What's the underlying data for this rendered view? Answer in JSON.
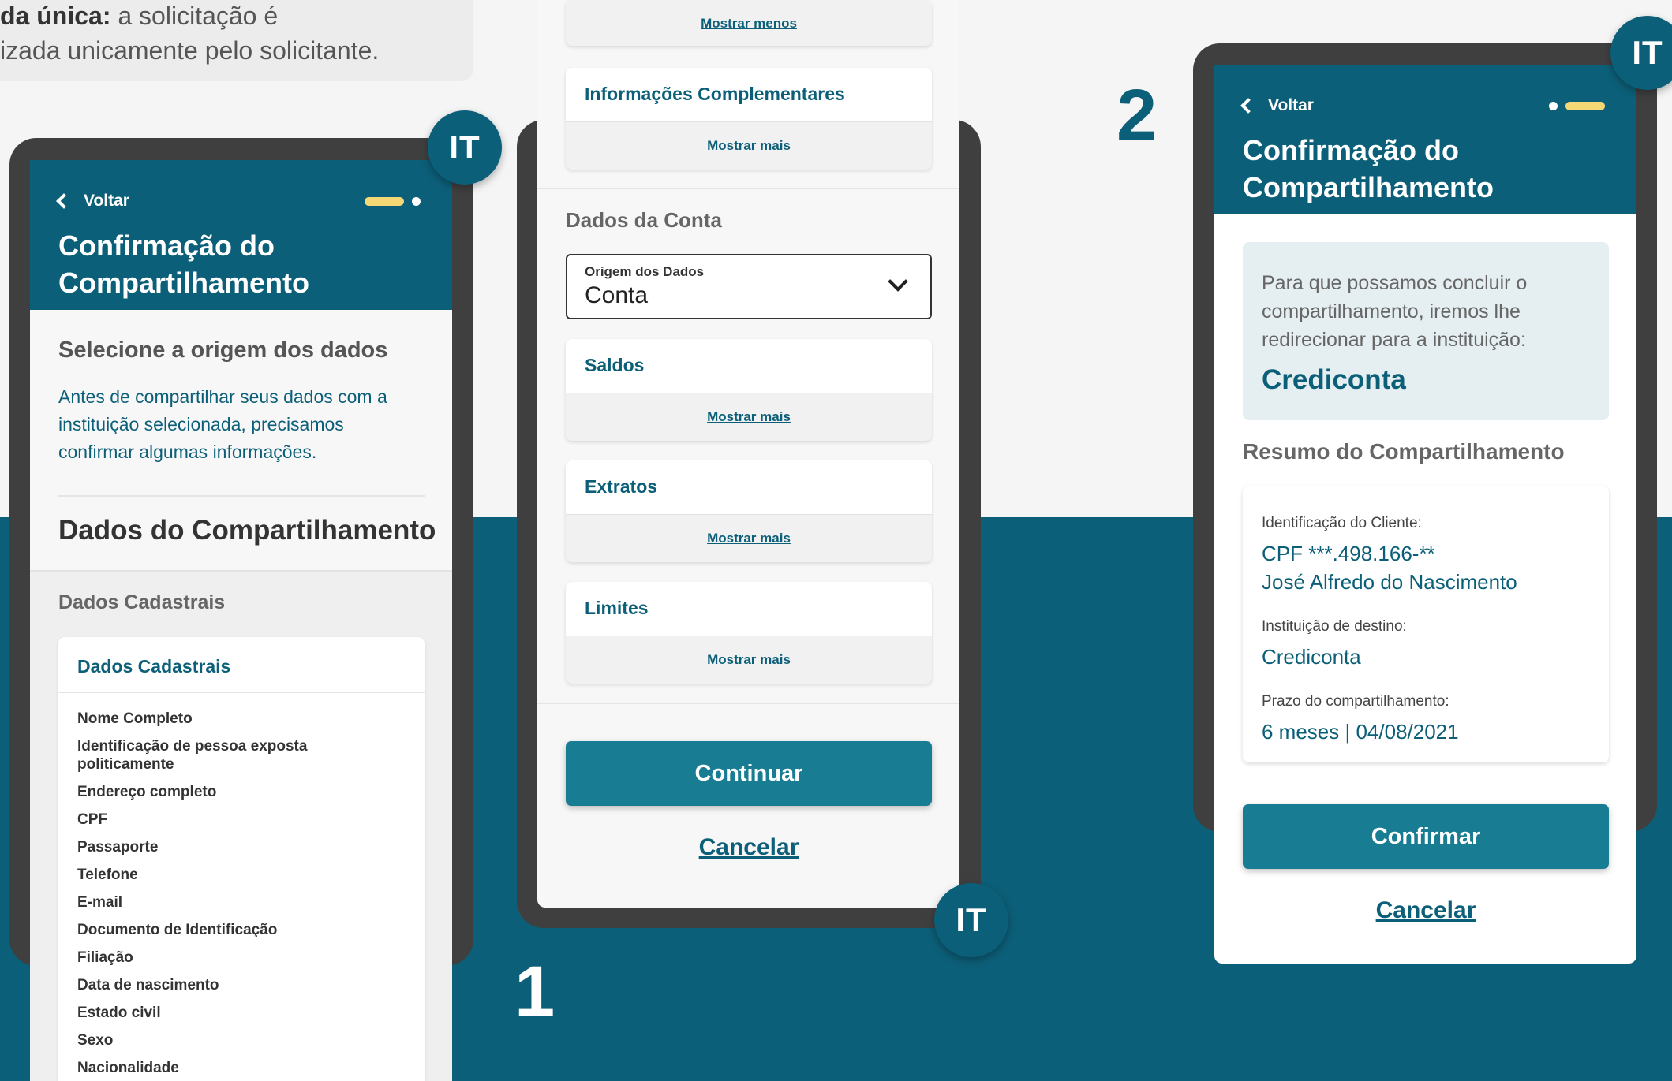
{
  "top_note": {
    "line1_bold": "da única:",
    "line1_rest": " a solicitação é",
    "line2": "izada unicamente pelo solicitante."
  },
  "badge_label": "IT",
  "step_numbers": {
    "one": "1",
    "two": "2"
  },
  "screen_left": {
    "back_label": "Voltar",
    "title_line1": "Confirmação do",
    "title_line2": "Compartilhamento",
    "section_heading": "Selecione a origem dos dados",
    "intro_line1": "Antes de compartilhar seus dados com a",
    "intro_line2": "instituição selecionada, precisamos",
    "intro_line3": "confirmar algumas informações.",
    "data_heading": "Dados do Compartilhamento",
    "group_label": "Dados Cadastrais",
    "card_title": "Dados Cadastrais",
    "fields": [
      "Nome Completo",
      "Identificação de pessoa exposta",
      "politicamente",
      "Endereço completo",
      "CPF",
      "Passaporte",
      "Telefone",
      "E-mail",
      "Documento de Identificação",
      "Filiação",
      "Data de nascimento",
      "Estado civil",
      "Sexo",
      "Nacionalidade"
    ]
  },
  "screen_middle": {
    "show_less": "Mostrar menos",
    "complementary_title": "Informações Complementares",
    "show_more": "Mostrar mais",
    "account_heading": "Dados da Conta",
    "select_label": "Origem dos Dados",
    "select_value": "Conta",
    "cards": [
      "Saldos",
      "Extratos",
      "Limites"
    ],
    "continue_label": "Continuar",
    "cancel_label": "Cancelar"
  },
  "screen_right": {
    "back_label": "Voltar",
    "title_line1": "Confirmação do",
    "title_line2": "Compartilhamento",
    "redirect_line1": "Para que possamos concluir o",
    "redirect_line2": "compartilhamento, iremos lhe",
    "redirect_line3": "redirecionar para a instituição:",
    "institution": "Crediconta",
    "summary_heading": "Resumo do Compartilhamento",
    "client_id_label": "Identificação do Cliente:",
    "client_cpf": "CPF ***.498.166-**",
    "client_name": "José Alfredo do Nascimento",
    "destination_label": "Instituição de destino:",
    "destination_value": "Crediconta",
    "term_label": "Prazo do compartilhamento:",
    "term_value": "6 meses | 04/08/2021",
    "confirm_label": "Confirmar",
    "cancel_label": "Cancelar"
  },
  "colors": {
    "brand_teal": "#0c5f78",
    "button_teal": "#187c93",
    "step_pill": "#f6d776",
    "frame": "#3f3f3f"
  }
}
